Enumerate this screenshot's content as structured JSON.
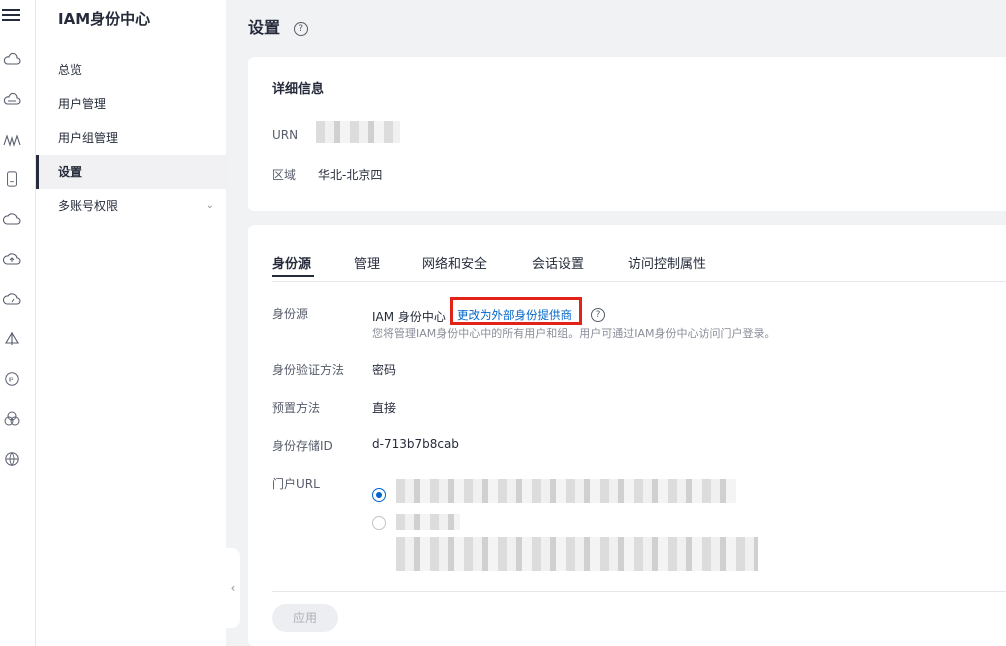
{
  "nav": {
    "title": "IAM身份中心",
    "items": [
      {
        "label": "总览"
      },
      {
        "label": "用户管理"
      },
      {
        "label": "用户组管理"
      },
      {
        "label": "设置"
      },
      {
        "label": "多账号权限"
      }
    ],
    "active": "设置",
    "rail_icons": [
      "cloud-icon",
      "cloud-icon",
      "waveform-icon",
      "phone-icon",
      "cloud-icon",
      "cloud-upload-icon",
      "gauge-icon",
      "sail-icon",
      "ip-icon",
      "cloud-group-icon",
      "globe-icon"
    ]
  },
  "page": {
    "title": "设置"
  },
  "details": {
    "title": "详细信息",
    "urn_label": "URN",
    "region_label": "区域",
    "region_value": "华北-北京四"
  },
  "tabs": [
    {
      "label": "身份源"
    },
    {
      "label": "管理"
    },
    {
      "label": "网络和安全"
    },
    {
      "label": "会话设置"
    },
    {
      "label": "访问控制属性"
    }
  ],
  "active_tab": "身份源",
  "identity": {
    "source_label": "身份源",
    "source_value": "IAM 身份中心",
    "change_link": "更改为外部身份提供商",
    "description": "您将管理IAM身份中心中的所有用户和组。用户可通过IAM身份中心访问门户登录。",
    "auth_label": "身份验证方法",
    "auth_value": "密码",
    "provision_label": "预置方法",
    "provision_value": "直接",
    "store_label": "身份存储ID",
    "store_value": "d-713b7b8cab",
    "portal_label": "门户URL",
    "portal_selected": 0
  },
  "apply_button": "应用",
  "colors": {
    "accent": "#0066cc",
    "highlight_box": "#e2231a",
    "background": "#f1f2f3"
  }
}
